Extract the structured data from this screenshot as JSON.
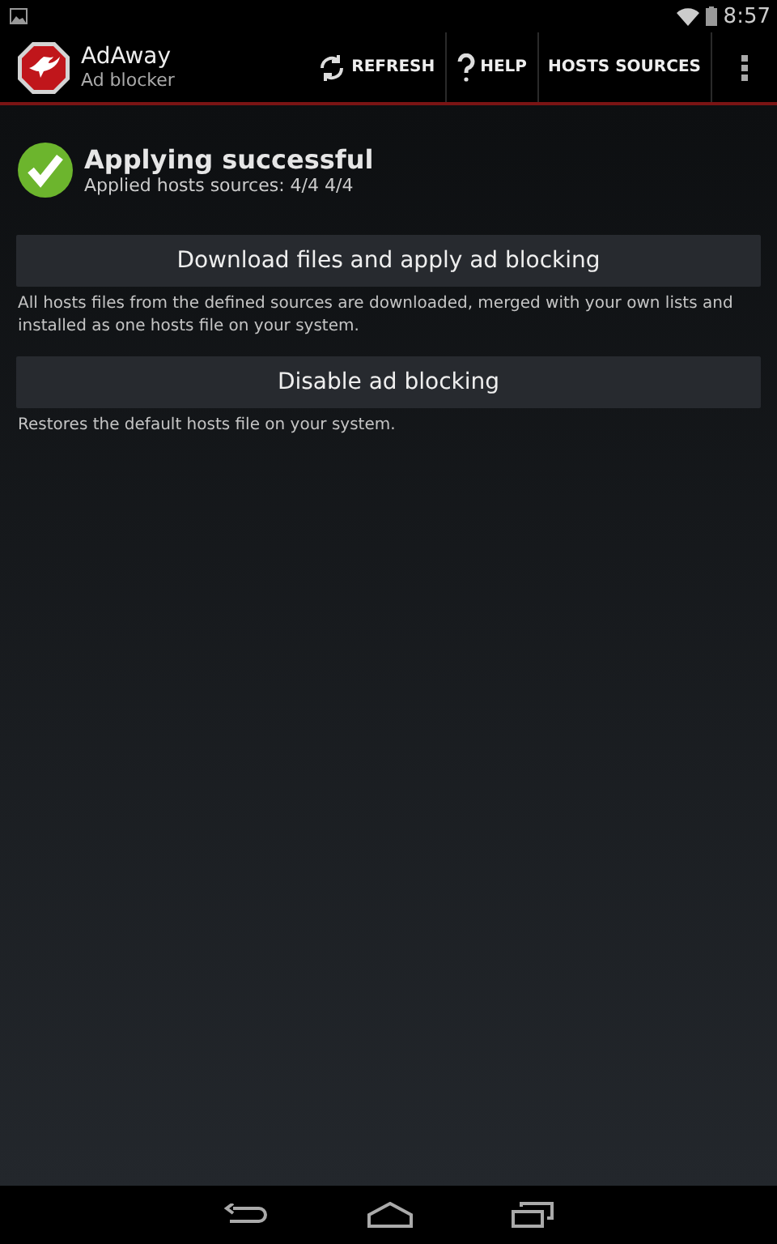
{
  "status_bar": {
    "time": "8:57"
  },
  "action_bar": {
    "title": "AdAway",
    "subtitle": "Ad blocker",
    "actions": [
      {
        "label": "REFRESH",
        "kind": "refresh"
      },
      {
        "label": "HELP",
        "kind": "help"
      },
      {
        "label": "HOSTS SOURCES",
        "kind": "text"
      }
    ]
  },
  "status": {
    "title": "Applying successful",
    "detail": "Applied hosts sources: 4/4 4/4"
  },
  "commands": [
    {
      "label": "Download files and apply ad blocking",
      "description": "All hosts files from the defined sources are downloaded, merged with your own lists and installed as one hosts file on your system."
    },
    {
      "label": "Disable ad blocking",
      "description": "Restores the default hosts file on your system."
    }
  ]
}
